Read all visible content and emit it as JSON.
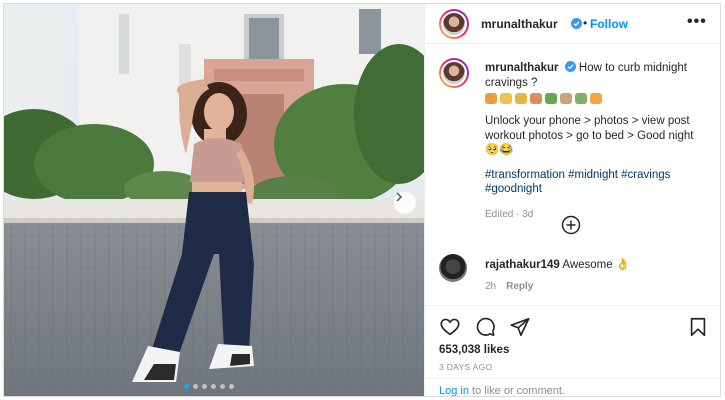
{
  "post": {
    "username": "mrunalthakur",
    "follow_label": "Follow",
    "bullet": "•",
    "more_label": "•••",
    "caption": {
      "username": "mrunalthakur",
      "text_line1": "How to curb midnight cravings ?",
      "emojis": [
        {
          "name": "burger-emoji",
          "color": "#e8a13a"
        },
        {
          "name": "fries-emoji",
          "color": "#f2c14e"
        },
        {
          "name": "taco-emoji",
          "color": "#e9b44c"
        },
        {
          "name": "hotdog-emoji",
          "color": "#d98c5f"
        },
        {
          "name": "melon-emoji",
          "color": "#6aa84f"
        },
        {
          "name": "cake-emoji",
          "color": "#c9a27e"
        },
        {
          "name": "sandwich-emoji",
          "color": "#7fb069"
        },
        {
          "name": "pizza-emoji",
          "color": "#f1a93b"
        }
      ],
      "body": "Unlock your phone > photos > view post workout photos > go to bed > Good night 🥺😂",
      "hashtags": "#transformation #midnight #cravings #goodnight",
      "edited": "Edited · 3d"
    },
    "comment": {
      "username": "rajathakur149",
      "text": "Awesome 👌",
      "time": "2h",
      "reply_label": "Reply"
    },
    "likes": "653,038 likes",
    "date": "3 DAYS AGO",
    "login_link": "Log in",
    "login_suffix": " to like or comment."
  },
  "colors": {
    "accent": "#0095f6",
    "hashtag": "#00376b",
    "muted": "#8e8e8e",
    "verified": "#3897f0"
  },
  "carousel": {
    "slides": 6,
    "active_index": 0
  }
}
